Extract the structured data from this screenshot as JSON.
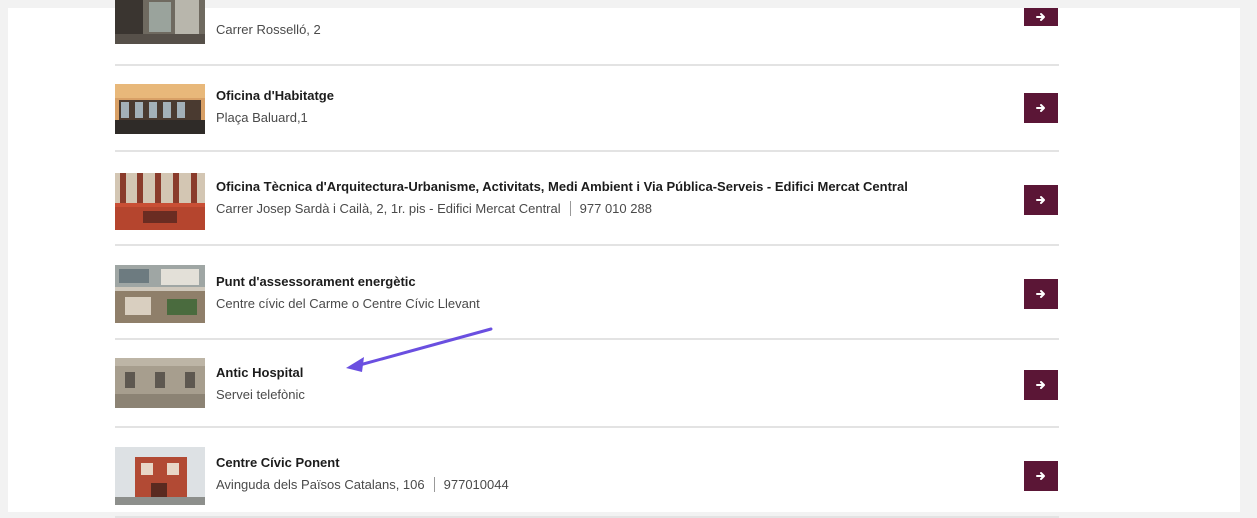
{
  "colors": {
    "accent": "#5b1636",
    "annotation_arrow": "#6a4fe0",
    "separator": "#e3e3e3"
  },
  "icons": {
    "row_action": "arrow-right-icon"
  },
  "items": [
    {
      "title": "",
      "address": "Carrer Rosselló, 2",
      "phone": ""
    },
    {
      "title": "Oficina d'Habitatge",
      "address": "Plaça Baluard,1",
      "phone": ""
    },
    {
      "title": "Oficina Tècnica d'Arquitectura-Urbanisme, Activitats, Medi Ambient i Via Pública-Serveis - Edifici Mercat Central",
      "address": "Carrer Josep Sardà i Cailà, 2, 1r. pis - Edifici Mercat Central",
      "phone": "977 010 288"
    },
    {
      "title": "Punt d'assessorament energètic",
      "address": "Centre cívic del Carme o Centre Cívic Llevant",
      "phone": ""
    },
    {
      "title": "Antic Hospital",
      "address": "Servei telefònic",
      "phone": ""
    },
    {
      "title": "Centre Cívic Ponent",
      "address": "Avinguda dels Països Catalans, 106",
      "phone": "977010044"
    }
  ]
}
